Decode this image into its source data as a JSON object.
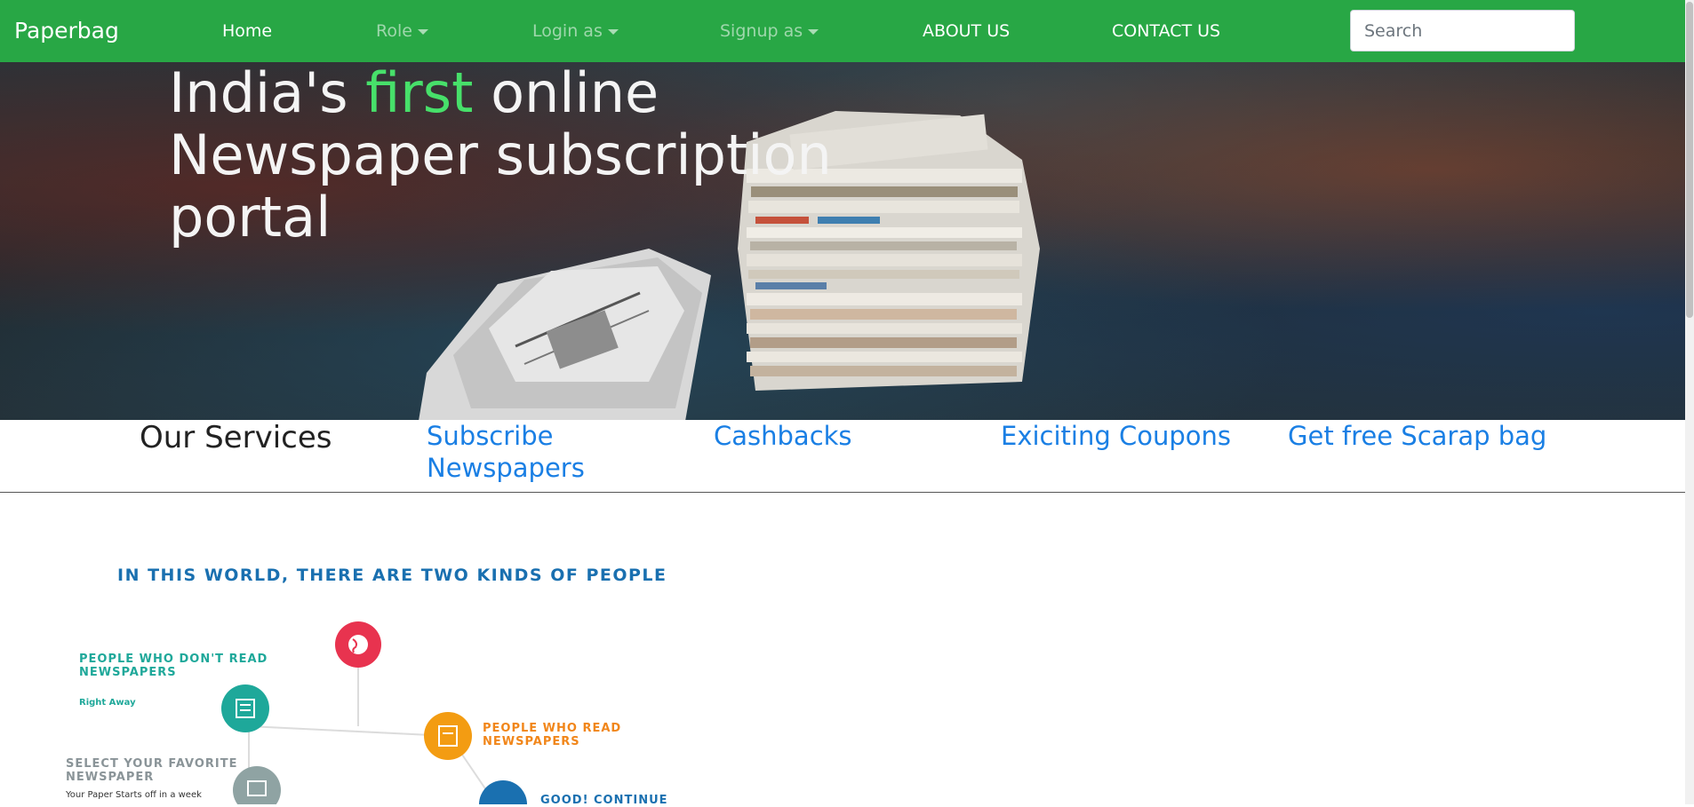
{
  "navbar": {
    "brand": "Paperbag",
    "home": "Home",
    "role": "Role",
    "login_as": "Login as",
    "signup_as": "Signup as",
    "about": "ABOUT US",
    "contact": "CONTACT US",
    "search_placeholder": "Search",
    "bg_color": "#28a745"
  },
  "hero": {
    "title_part1": "India's ",
    "title_accent": "first",
    "title_part2": " online Newspaper subscription portal",
    "accent_color": "#47e06a"
  },
  "services": {
    "title": "Our Services",
    "items": [
      {
        "label": "Subscribe Newspapers"
      },
      {
        "label": "Cashbacks"
      },
      {
        "label": "Exiciting Coupons"
      },
      {
        "label": "Get free Scarap bag"
      }
    ],
    "link_color": "#1a7fe4"
  },
  "infographic": {
    "heading": "IN THIS WORLD, THERE ARE TWO KINDS OF PEOPLE",
    "non_readers": "PEOPLE WHO DON'T READ NEWSPAPERS",
    "non_readers_sub": "Right Away",
    "readers": "PEOPLE WHO READ NEWSPAPERS",
    "select": "SELECT YOUR FAVORITE NEWSPAPER",
    "select_sub": "Your Paper Starts off in a week",
    "continue": "GOOD! CONTINUE",
    "icons": [
      "globe-icon",
      "newspaper-icon",
      "newspaper-reading-icon",
      "newspaper-select-icon",
      "continue-icon"
    ]
  }
}
